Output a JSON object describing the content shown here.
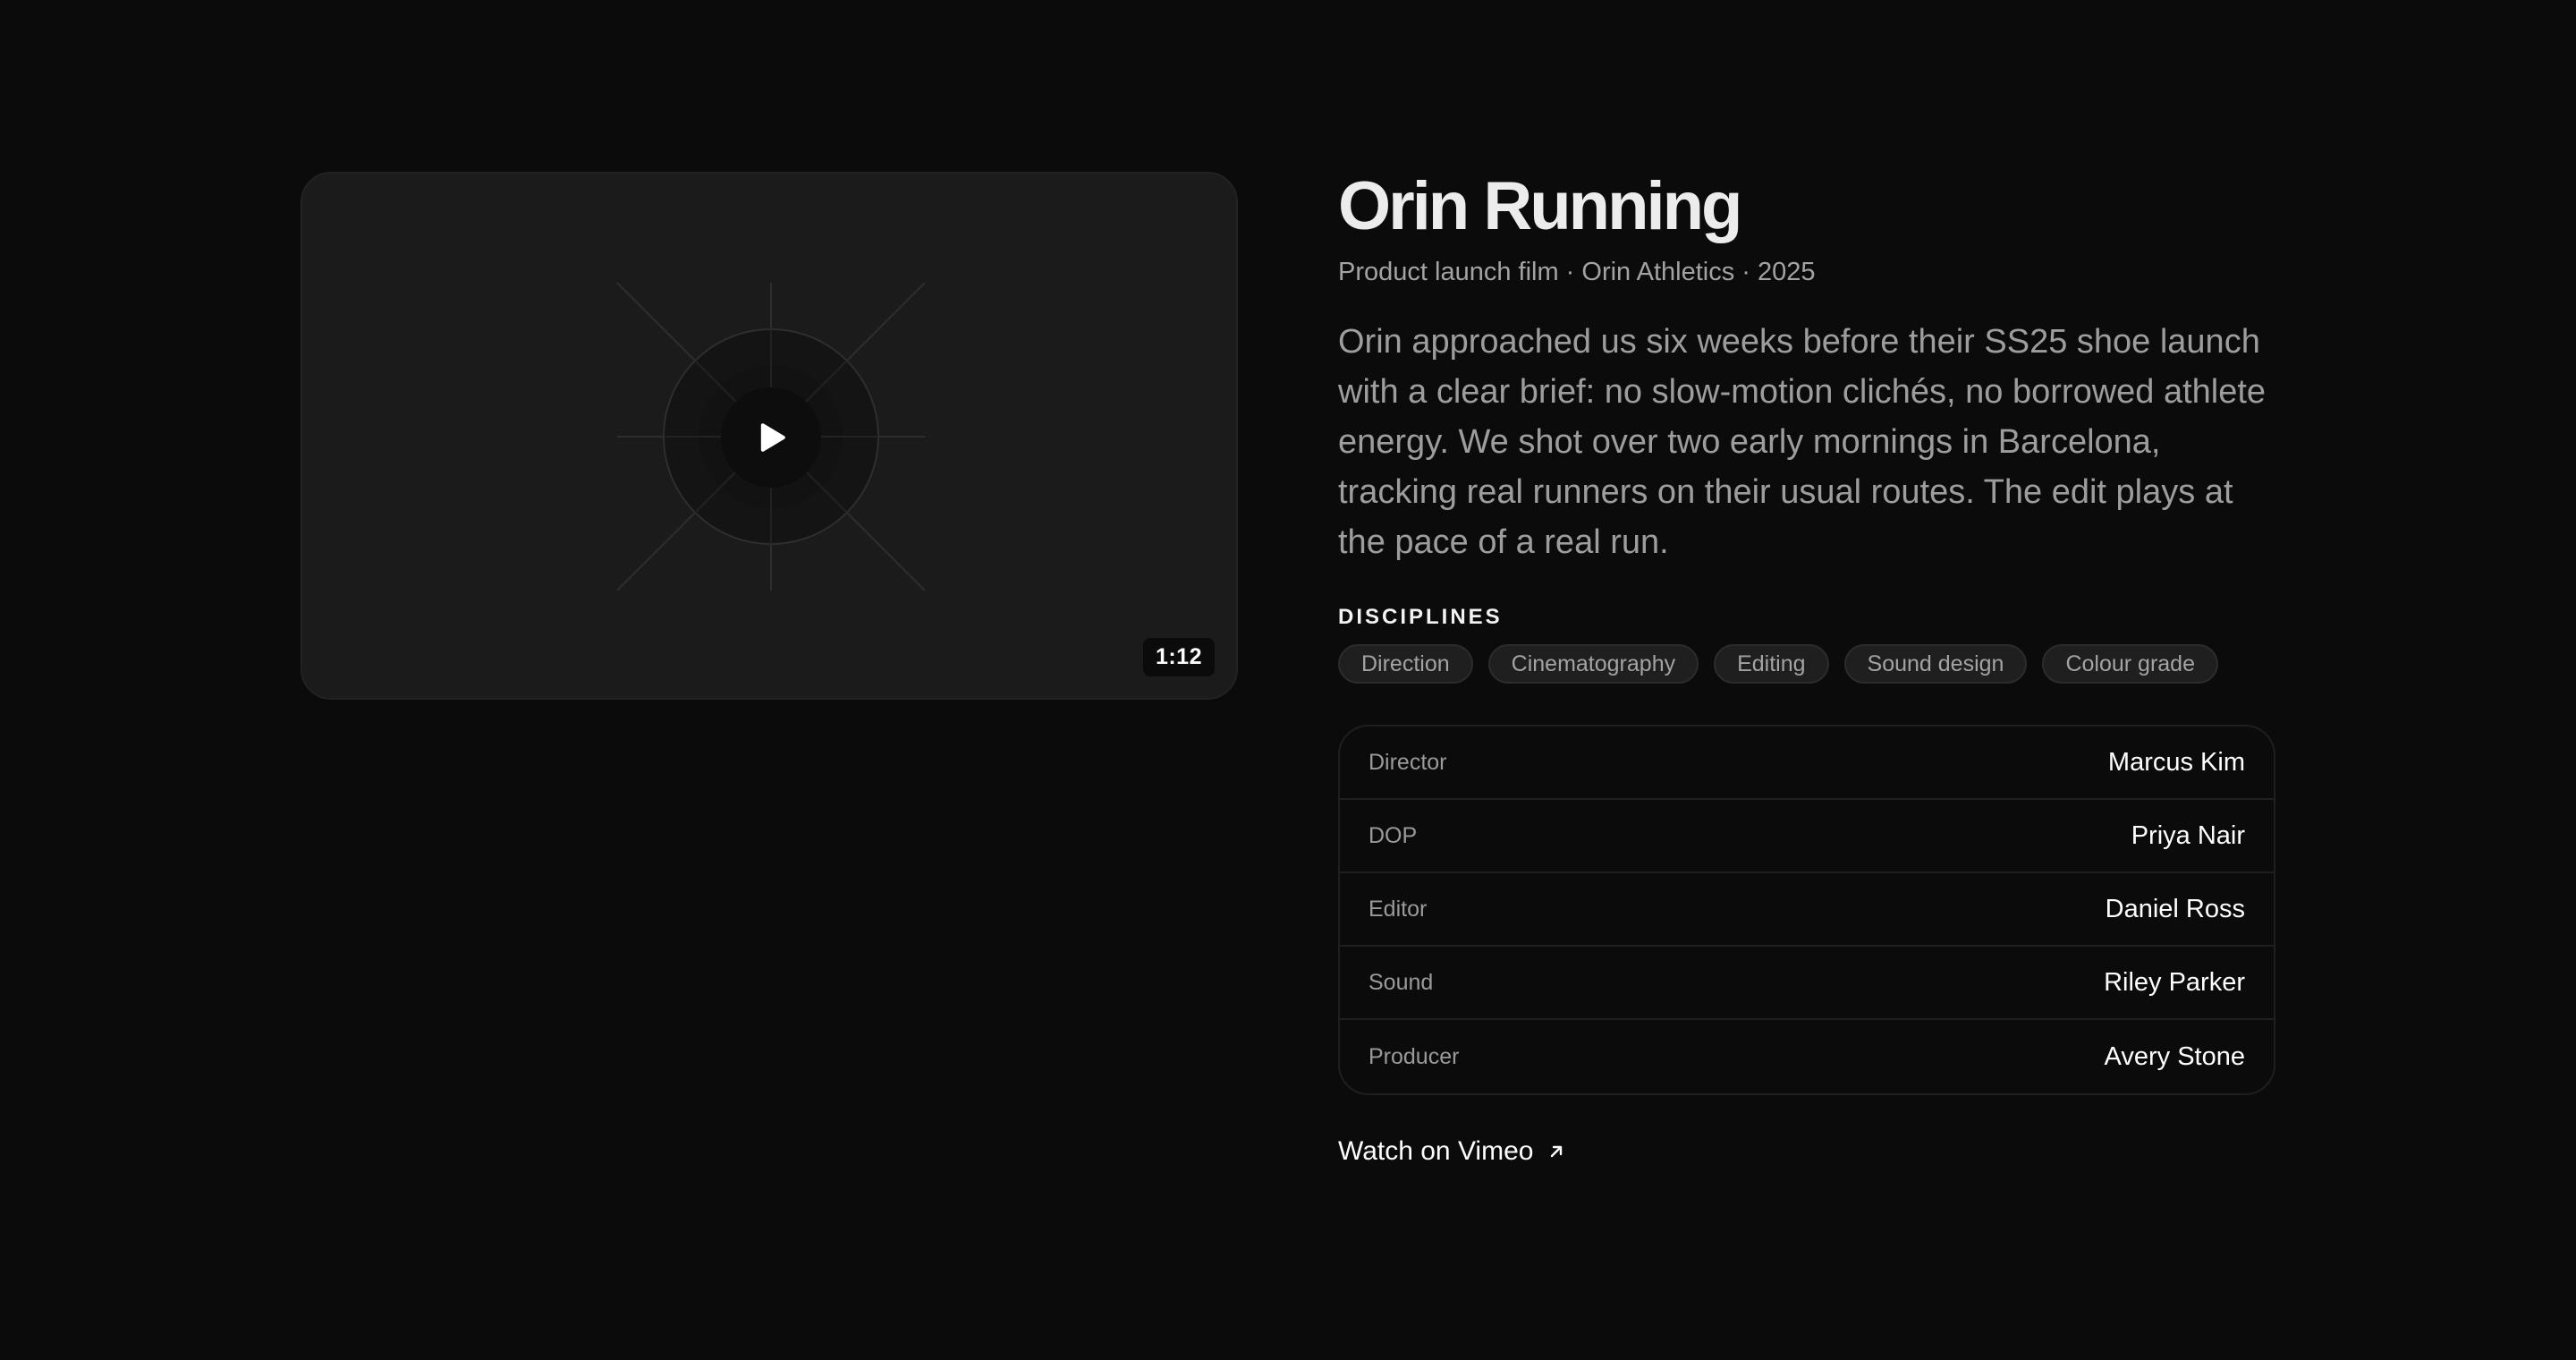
{
  "project": {
    "title": "Orin Running",
    "meta": "Product launch film · Orin Athletics · 2025",
    "description": "Orin approached us six weeks before their SS25 shoe launch with a clear brief: no slow-motion clichés, no borrowed athlete energy. We shot over two early mornings in Barcelona, tracking real runners on their usual routes. The edit plays at the pace of a real run."
  },
  "video": {
    "duration": "1:12",
    "play_icon": "play-icon"
  },
  "disciplines": {
    "label": "DISCIPLINES",
    "items": [
      "Direction",
      "Cinematography",
      "Editing",
      "Sound design",
      "Colour grade"
    ]
  },
  "credits": [
    {
      "role": "Director",
      "name": "Marcus Kim"
    },
    {
      "role": "DOP",
      "name": "Priya Nair"
    },
    {
      "role": "Editor",
      "name": "Daniel Ross"
    },
    {
      "role": "Sound",
      "name": "Riley Parker"
    },
    {
      "role": "Producer",
      "name": "Avery Stone"
    }
  ],
  "watch_link": {
    "label": "Watch on Vimeo",
    "icon": "arrow-up-right-icon"
  },
  "colors": {
    "background": "#0b0b0b",
    "card": "#1b1b1b",
    "text_primary": "#ffffff",
    "text_muted": "#9d9d9d"
  }
}
